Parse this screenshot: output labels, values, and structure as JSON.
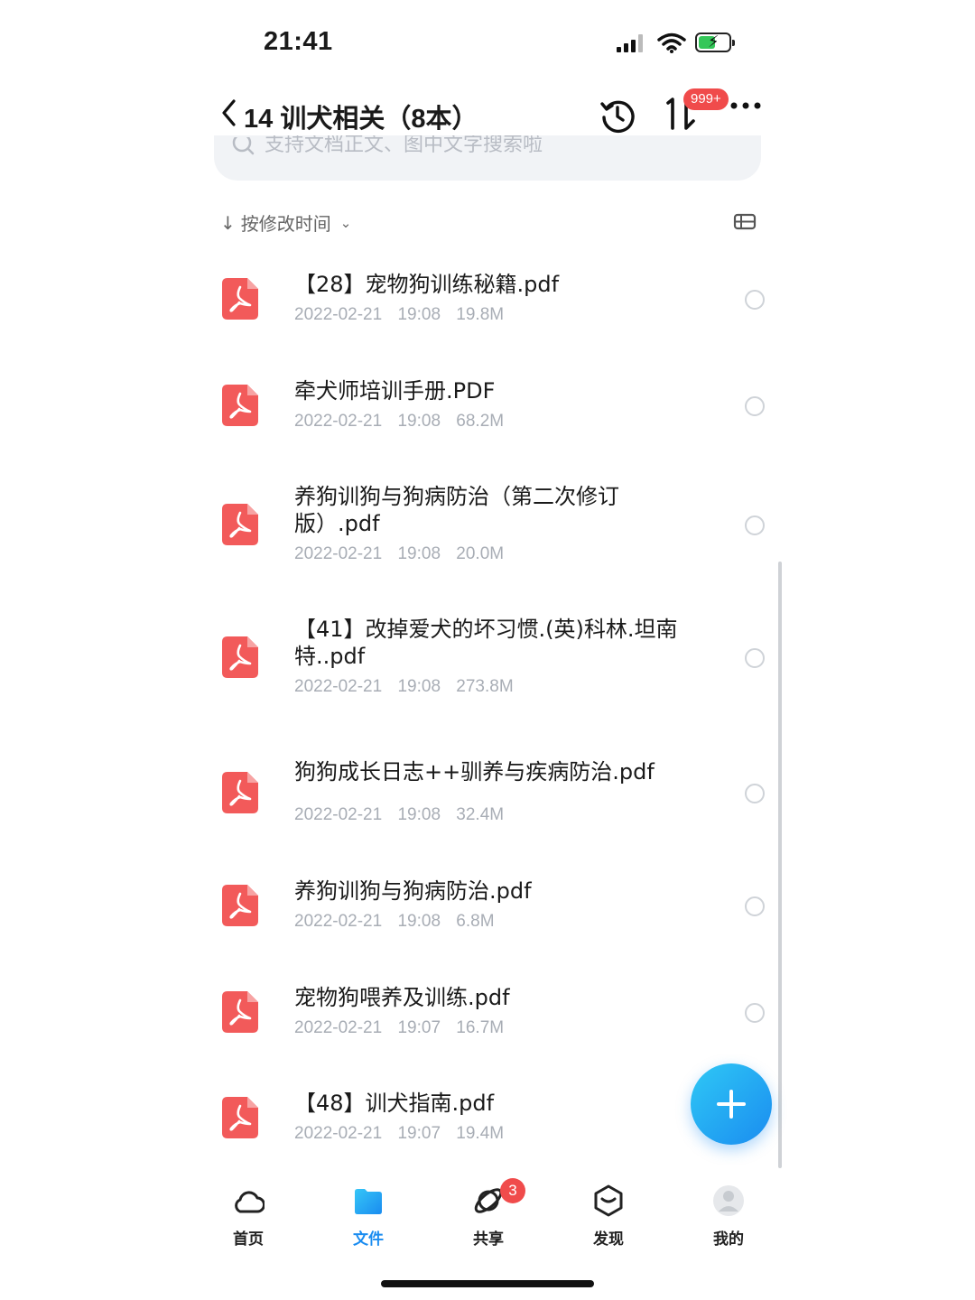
{
  "status_bar": {
    "time": "21:41"
  },
  "header": {
    "title": "14 训犬相关（8本）",
    "notification_badge": "999+"
  },
  "search": {
    "placeholder": "支持文档正文、图中文字搜索啦"
  },
  "sort": {
    "label": "按修改时间"
  },
  "files": [
    {
      "name": "【28】宠物狗训练秘籍.pdf",
      "date": "2022-02-21 19:08",
      "size": "19.8M"
    },
    {
      "name": "牵犬师培训手册.PDF",
      "date": "2022-02-21 19:08",
      "size": "68.2M"
    },
    {
      "name": "养狗训狗与狗病防治（第二次修订版）.pdf",
      "date": "2022-02-21 19:08",
      "size": "20.0M"
    },
    {
      "name": "【41】改掉爱犬的坏习惯.(英)科林.坦南特..pdf",
      "date": "2022-02-21 19:08",
      "size": "273.8M"
    },
    {
      "name": "狗狗成长日志++驯养与疾病防治.pdf",
      "date": "2022-02-21 19:08",
      "size": "32.4M"
    },
    {
      "name": "养狗训狗与狗病防治.pdf",
      "date": "2022-02-21 19:08",
      "size": "6.8M"
    },
    {
      "name": "宠物狗喂养及训练.pdf",
      "date": "2022-02-21 19:07",
      "size": "16.7M"
    },
    {
      "name": "【48】训犬指南.pdf",
      "date": "2022-02-21 19:07",
      "size": "19.4M"
    }
  ],
  "tabs": [
    {
      "label": "首页",
      "icon": "cloud-icon"
    },
    {
      "label": "文件",
      "icon": "folder-icon",
      "active": true
    },
    {
      "label": "共享",
      "icon": "share-orbit-icon",
      "badge": "3"
    },
    {
      "label": "发现",
      "icon": "cube-icon"
    },
    {
      "label": "我的",
      "icon": "avatar-icon"
    }
  ],
  "colors": {
    "accent": "#1a8cf0",
    "pdf_red": "#f25a5a",
    "badge_red": "#f04b4b"
  }
}
